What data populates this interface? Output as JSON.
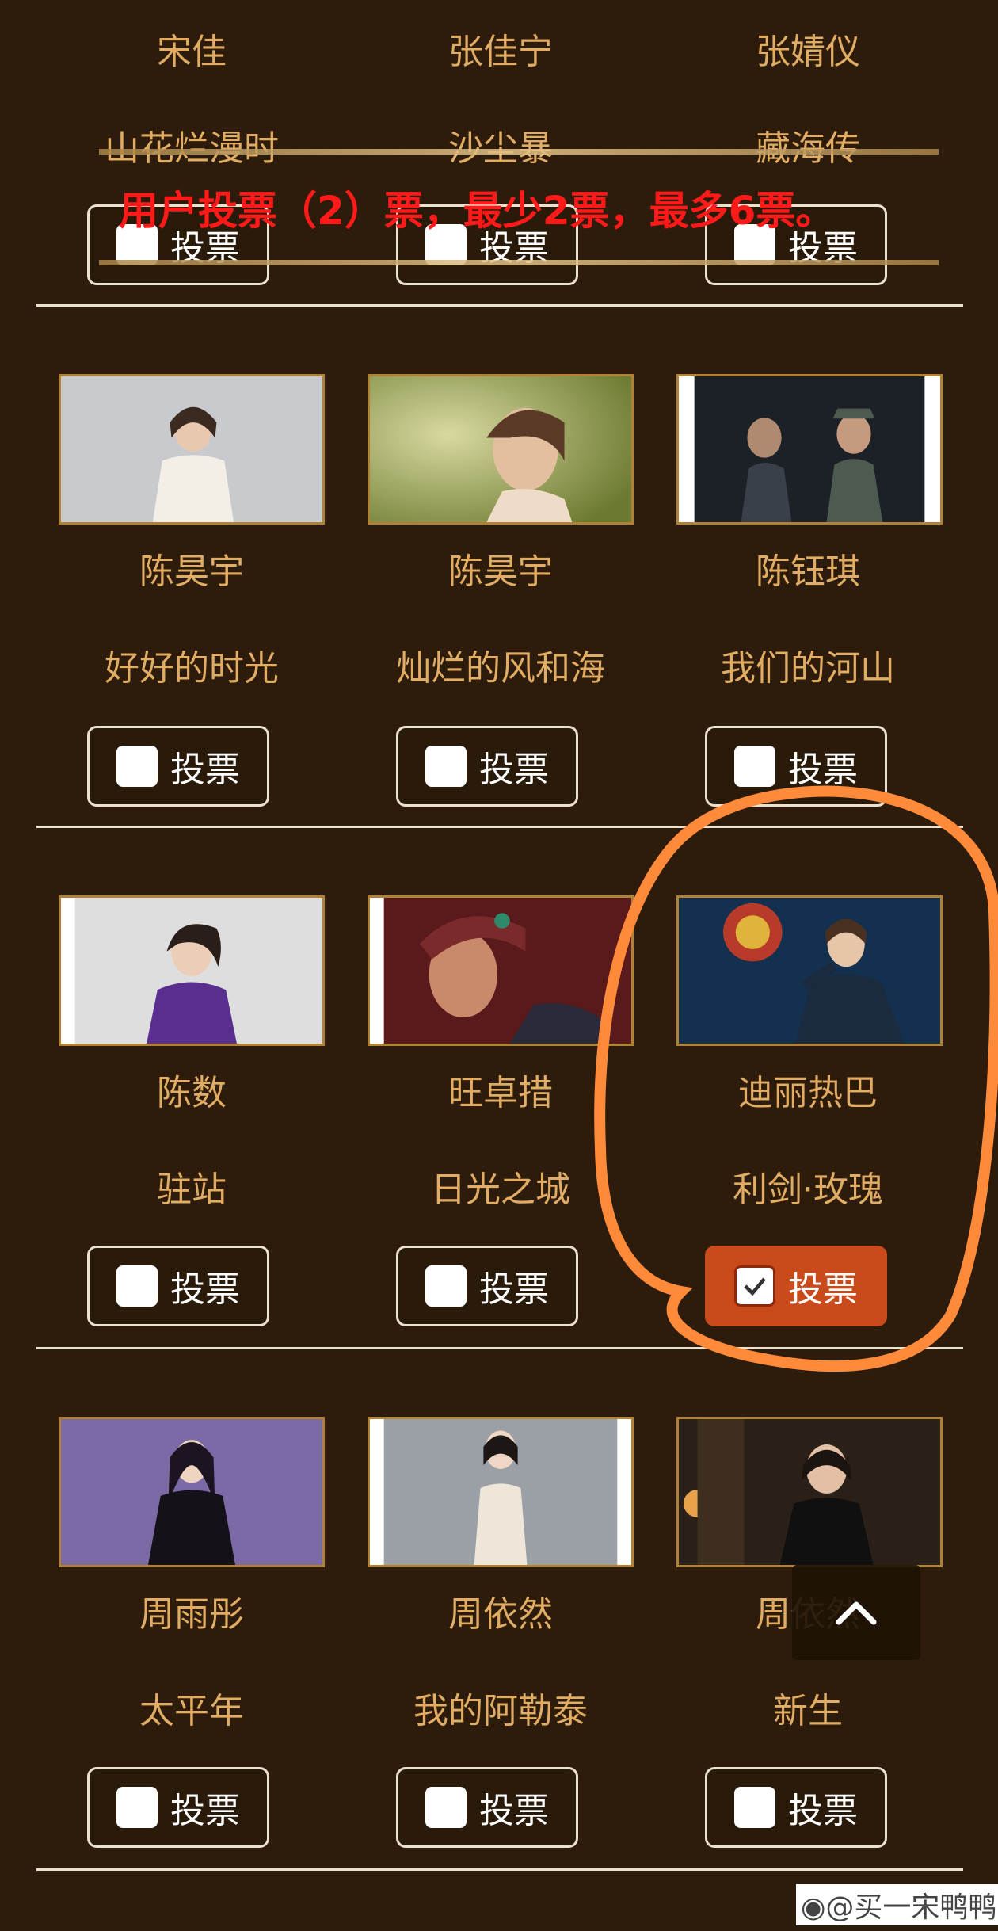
{
  "notice": {
    "text": "用户投票（2）票，最少2票，最多6票。"
  },
  "vote_label": "投票",
  "rows": [
    {
      "cells": [
        {
          "name": "宋佳",
          "title": "山花烂漫时",
          "checked": false
        },
        {
          "name": "张佳宁",
          "title": "沙尘暴",
          "checked": false
        },
        {
          "name": "张婧仪",
          "title": "藏海传",
          "checked": false
        }
      ]
    },
    {
      "cells": [
        {
          "name": "陈昊宇",
          "title": "好好的时光",
          "checked": false
        },
        {
          "name": "陈昊宇",
          "title": "灿烂的风和海",
          "checked": false
        },
        {
          "name": "陈钰琪",
          "title": "我们的河山",
          "checked": false
        }
      ]
    },
    {
      "cells": [
        {
          "name": "陈数",
          "title": "驻站",
          "checked": false
        },
        {
          "name": "旺卓措",
          "title": "日光之城",
          "checked": false
        },
        {
          "name": "迪丽热巴",
          "title": "利剑·玫瑰",
          "checked": true
        }
      ]
    },
    {
      "cells": [
        {
          "name": "周雨彤",
          "title": "太平年",
          "checked": false
        },
        {
          "name": "周依然",
          "title": "我的阿勒泰",
          "checked": false
        },
        {
          "name": "周依然",
          "title": "新生",
          "checked": false
        }
      ]
    }
  ],
  "watermark": "@买一宋鸭鸭",
  "icons": {
    "scroll_top": "chevron-up-icon",
    "check": "check-icon",
    "weibo": "weibo-logo-icon"
  },
  "colors": {
    "background": "#2d1c0b",
    "text_gold": "#e1ac63",
    "checked_button": "#c94a1a",
    "highlight_circle": "#ff8a3a",
    "notice_red": "#ff1a1a"
  }
}
